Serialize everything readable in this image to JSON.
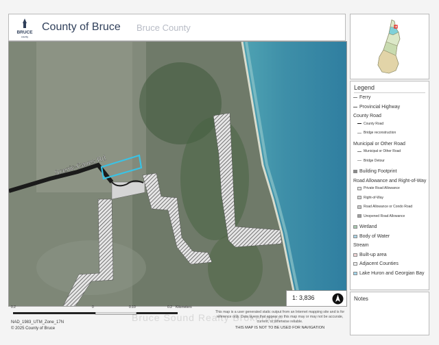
{
  "header": {
    "title": "County of Bruce",
    "subtitle": "Bruce County",
    "logo_text": "BRUCE",
    "logo_subtext": "county"
  },
  "map": {
    "road_label": "Scenic-Caves Rd",
    "scale_ratio": "1: 3,836",
    "north_label": "N",
    "colors": {
      "water": "#3f8ea7",
      "forest": "#6f7a69",
      "parcel_outline": "#39c3e6",
      "road": "#1b1b1b",
      "shoreline": "#d9dccd"
    }
  },
  "legend": {
    "title": "Legend",
    "items": [
      {
        "label": "Ferry",
        "kind": "line",
        "level": "main",
        "color": "#7a7a7a"
      },
      {
        "label": "Provincial Highway",
        "kind": "line",
        "level": "main",
        "color": "#555555"
      },
      {
        "label": "County Road",
        "kind": "none",
        "level": "main",
        "color": ""
      },
      {
        "label": "County Road",
        "kind": "line",
        "level": "sub",
        "color": "#111111"
      },
      {
        "label": "Bridge reconstruction",
        "kind": "line",
        "level": "sub",
        "color": "#999999"
      },
      {
        "label": "Municipal or Other Road",
        "kind": "none",
        "level": "main",
        "color": ""
      },
      {
        "label": "Municipal or Other Road",
        "kind": "line",
        "level": "sub",
        "color": "#777777"
      },
      {
        "label": "Bridge Detour",
        "kind": "line",
        "level": "sub",
        "color": "#aaaaaa"
      },
      {
        "label": "Building Footprint",
        "kind": "box",
        "level": "main",
        "color": "#8a8a8a"
      },
      {
        "label": "Road Allowance and Right-of-Way",
        "kind": "none",
        "level": "main",
        "color": ""
      },
      {
        "label": "Private Road Allowance",
        "kind": "box",
        "level": "sub",
        "color": "#e2e2e2"
      },
      {
        "label": "Right-of-Way",
        "kind": "box",
        "level": "sub",
        "color": "#d5d5d5"
      },
      {
        "label": "Road Allowance or Condo Road",
        "kind": "box",
        "level": "sub",
        "color": "#c9c9c9"
      },
      {
        "label": "Unopened Road Allowance",
        "kind": "box",
        "level": "sub",
        "color": "#9f9f9f"
      },
      {
        "label": "Wetland",
        "kind": "box",
        "level": "main",
        "color": "#a8c9b0"
      },
      {
        "label": "Body of Water",
        "kind": "box",
        "level": "main",
        "color": "#a9d3e6"
      },
      {
        "label": "Stream",
        "kind": "none",
        "level": "main",
        "color": ""
      },
      {
        "label": "Built-up area",
        "kind": "box",
        "level": "main",
        "color": "#f1d6d6"
      },
      {
        "label": "Adjacent Counties",
        "kind": "box",
        "level": "main",
        "color": "#ededed"
      },
      {
        "label": "Lake Huron and Georgian Bay",
        "kind": "box",
        "level": "main",
        "color": "#a4d6ec"
      }
    ]
  },
  "notes": {
    "title": "Notes"
  },
  "footer": {
    "scalebar_labels": [
      "0.2",
      "0",
      "0.10",
      "0.2",
      "Kilometers"
    ],
    "datum": "NAD_1983_UTM_Zone_17N",
    "copyright": "© 2025 County of Bruce",
    "disclaimer": "This map is a user generated static output from an Internet mapping site and is for reference only. Data layers that appear on this map may or may not be accurate, current, or otherwise reliable.",
    "disclaimer_bold": "THIS MAP IS NOT TO BE USED FOR NAVIGATION",
    "watermark": "Bruce Sound Realty Brokerage"
  }
}
